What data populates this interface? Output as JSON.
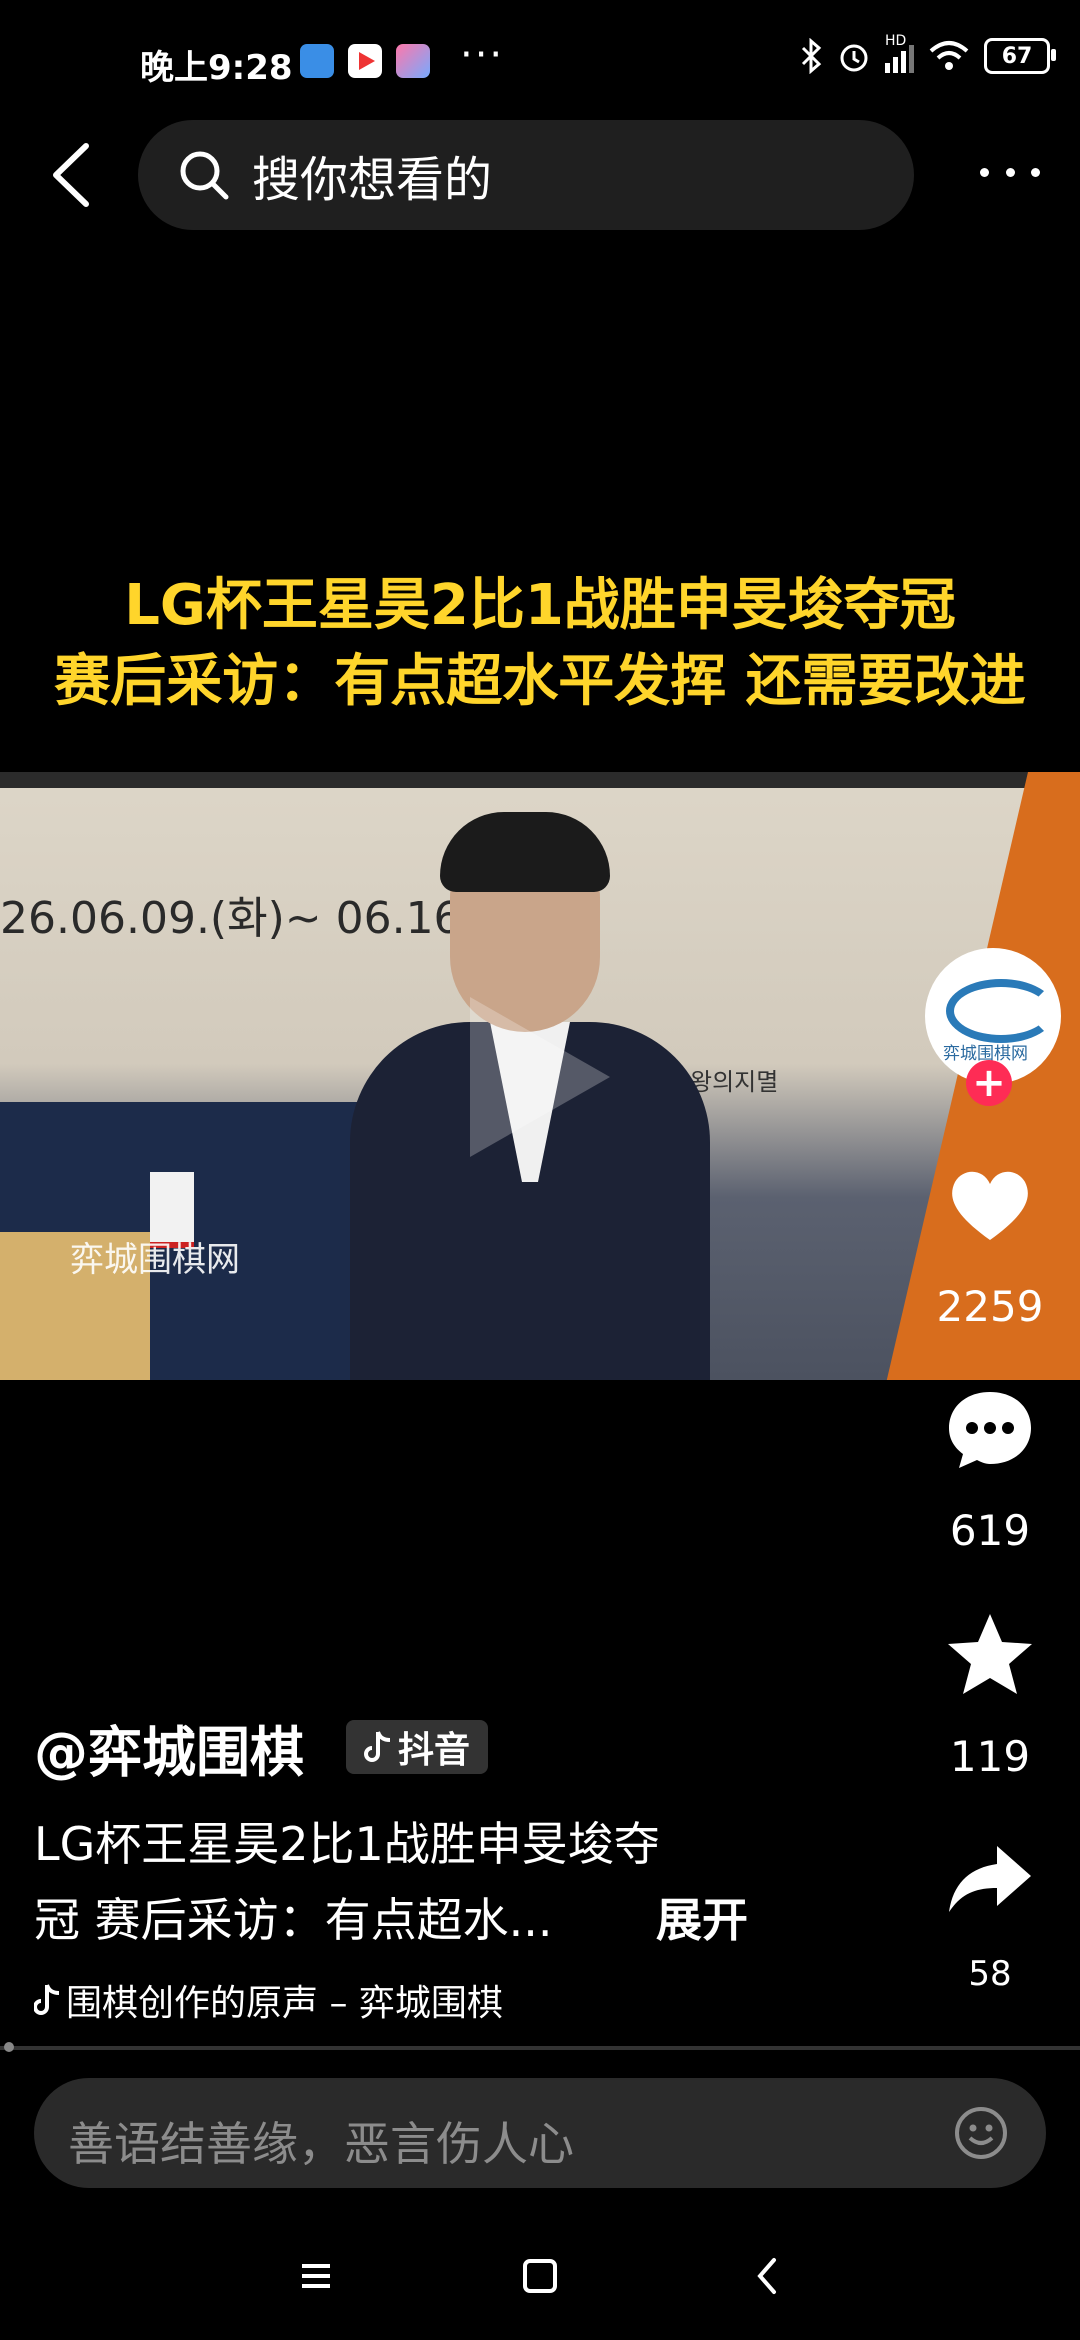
{
  "status": {
    "time": "晚上9:28",
    "more": "···",
    "network": "HD",
    "battery": "67"
  },
  "top": {
    "search_placeholder": "搜你想看的"
  },
  "caption": {
    "line1": "LG杯王星昊2比1战胜申旻埈夺冠",
    "line2": "赛后采访：有点超水平发挥 还需要改进"
  },
  "video": {
    "backdrop_date": "26.06.09.(화)~ 06.16",
    "backdrop_sign": "왕의지멸",
    "watermark": "弈城围棋网"
  },
  "rail": {
    "avatar_label": "弈城围棋网",
    "follow": "+",
    "likes": "2259",
    "comments": "619",
    "favorites": "119",
    "shares": "58"
  },
  "post": {
    "author": "@弈城围棋",
    "platform_badge": "抖音",
    "desc_line1": "LG杯王星昊2比1战胜申旻埈夺",
    "desc_line2": "冠 赛后采访：有点超水...",
    "expand": "展开",
    "music": "围棋创作的原声 – 弈城围棋"
  },
  "comment_bar": {
    "placeholder": "善语结善缘，恶言伤人心"
  },
  "colors": {
    "caption": "#ffd52b",
    "follow": "#fe2c55",
    "background": "#000000"
  }
}
